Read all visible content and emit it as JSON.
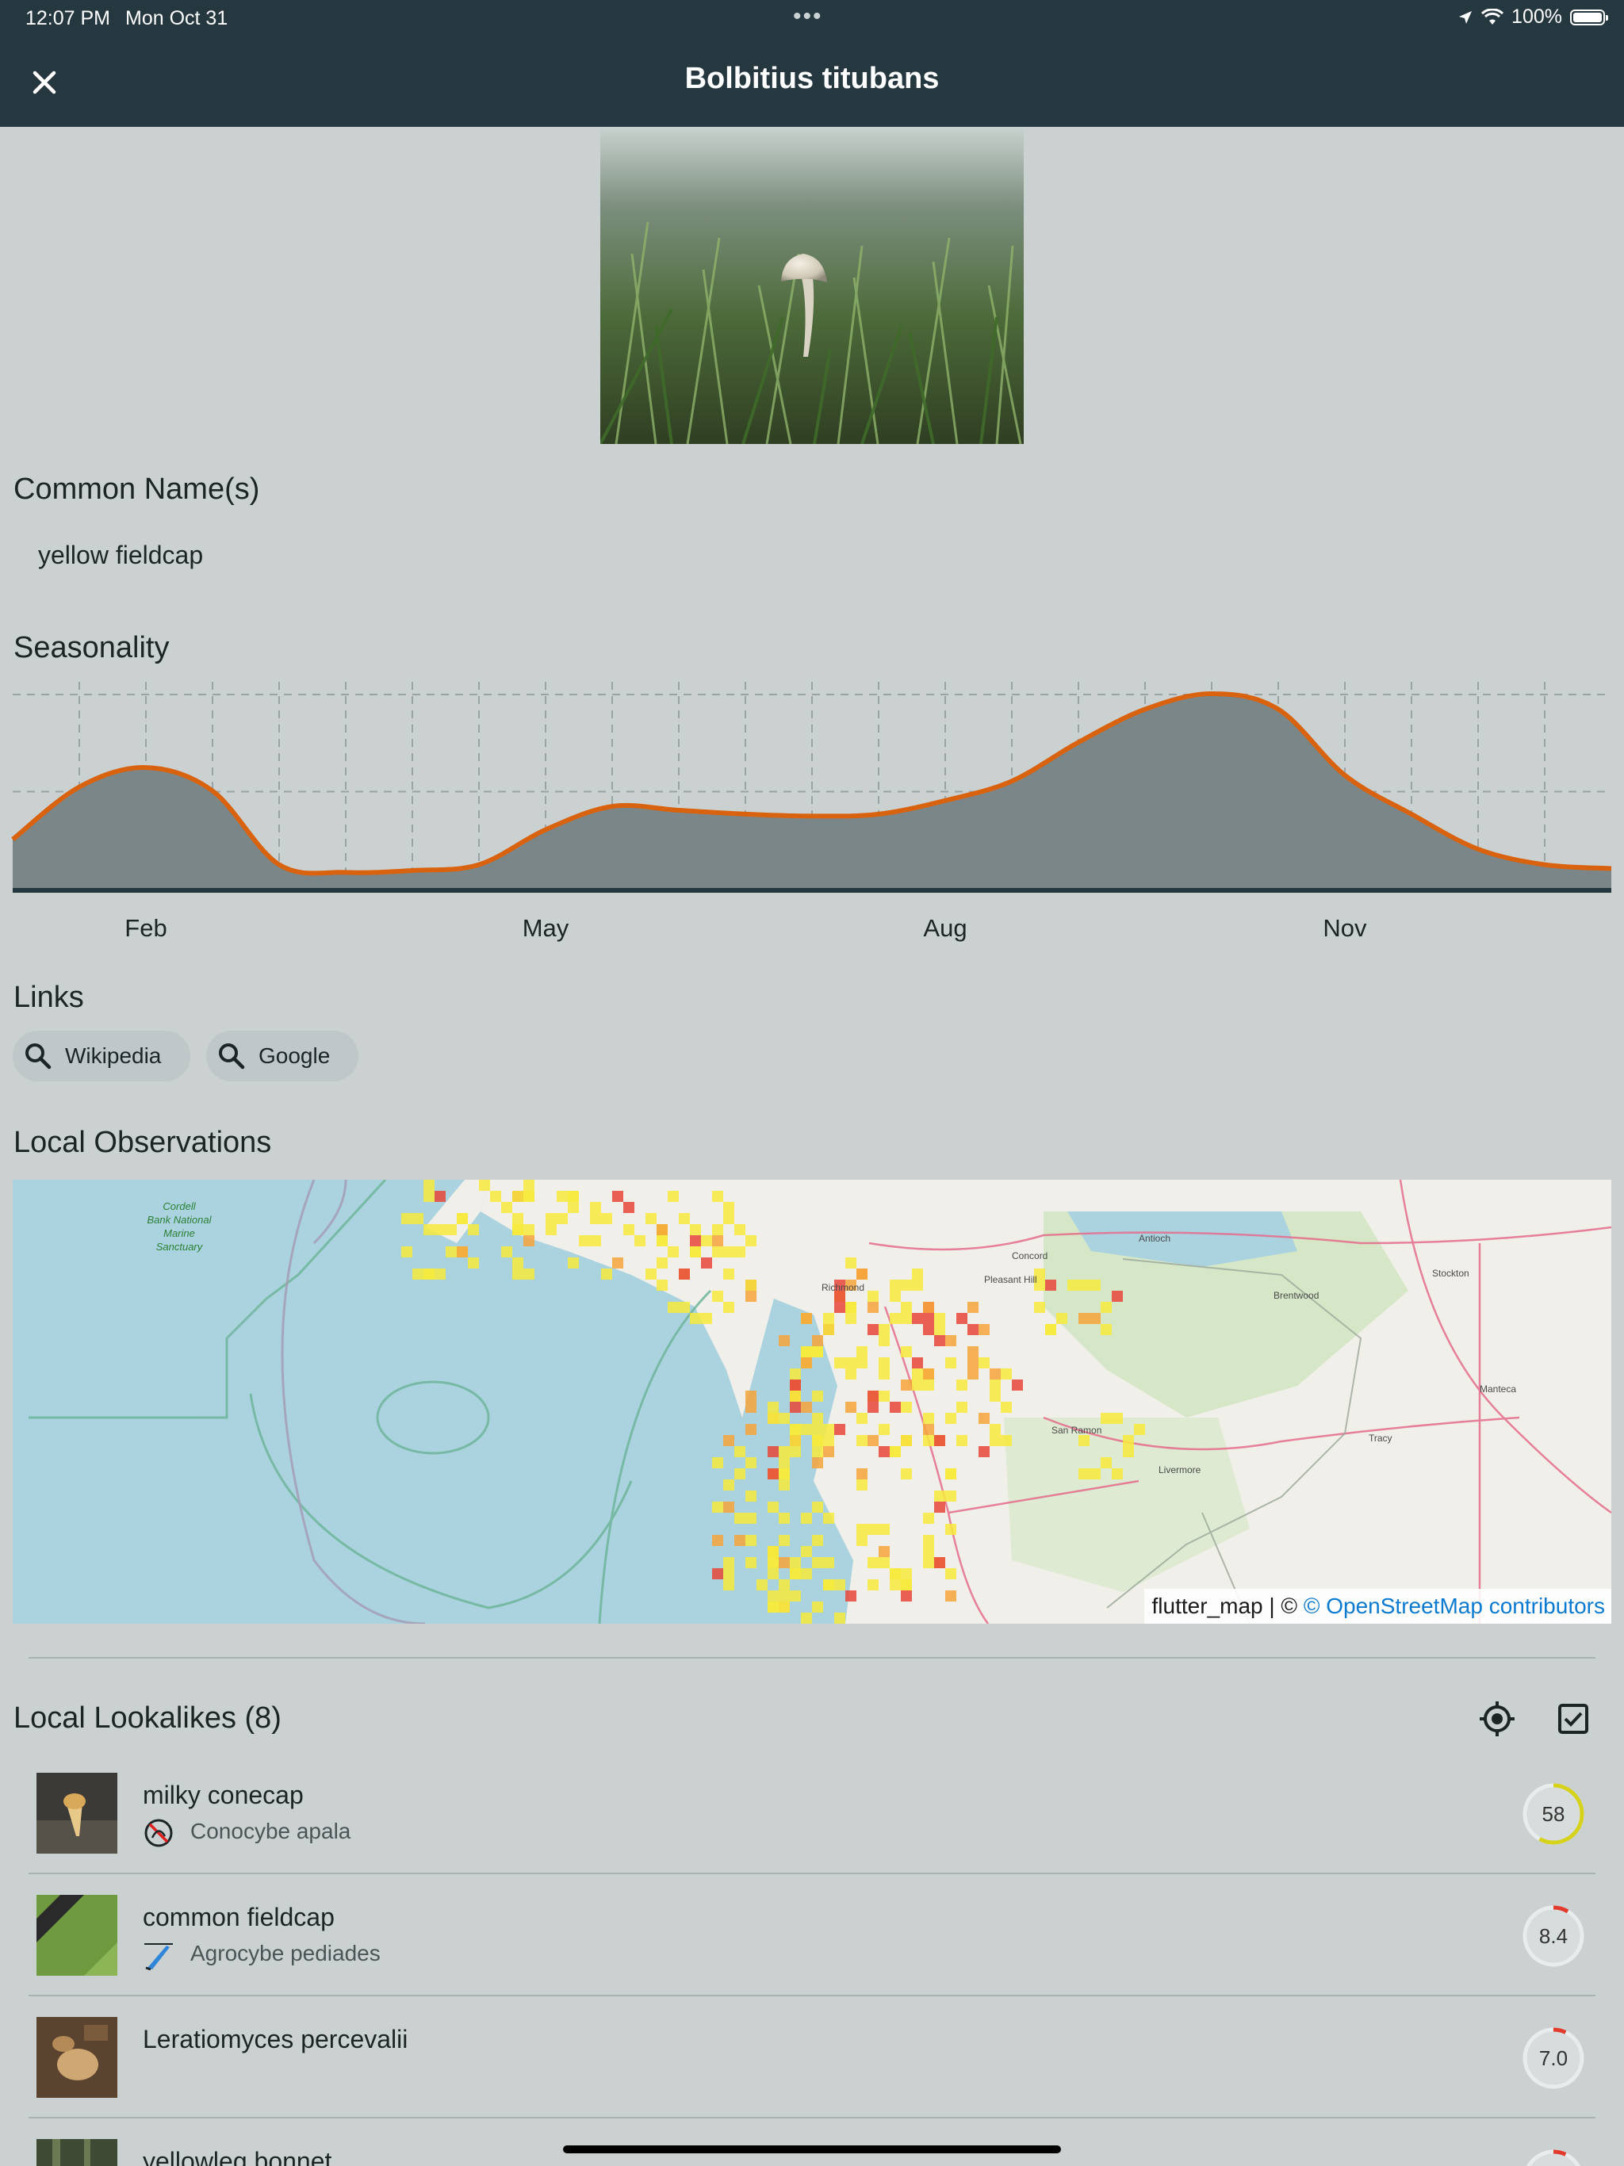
{
  "status": {
    "time": "12:07 PM",
    "date": "Mon Oct 31",
    "battery": "100%"
  },
  "appbar": {
    "title": "Bolbitius titubans",
    "close_icon": "close-icon"
  },
  "sections": {
    "common_names": "Common Name(s)",
    "seasonality": "Seasonality",
    "links": "Links",
    "observations": "Local Observations",
    "lookalikes": "Local Lookalikes (8)"
  },
  "common_name": "yellow fieldcap",
  "chart_data": {
    "type": "area",
    "title": "Seasonality",
    "x": [
      1,
      2,
      3,
      4,
      5,
      6,
      7,
      8,
      9,
      10,
      11,
      12,
      13,
      14,
      15,
      16,
      17,
      18,
      19,
      20,
      21,
      22,
      23,
      24,
      25
    ],
    "values": [
      0.25,
      0.52,
      0.62,
      0.5,
      0.12,
      0.08,
      0.09,
      0.12,
      0.3,
      0.42,
      0.4,
      0.38,
      0.37,
      0.38,
      0.45,
      0.55,
      0.75,
      0.92,
      1.0,
      0.92,
      0.58,
      0.38,
      0.2,
      0.12,
      0.1
    ],
    "tick_labels": [
      "Feb",
      "May",
      "Aug",
      "Nov"
    ],
    "ylim": [
      0,
      1
    ],
    "grid": true,
    "colors": {
      "line": "#d9620e",
      "fill": "#7b8689"
    }
  },
  "links": [
    {
      "label": "Wikipedia",
      "icon": "search-icon"
    },
    {
      "label": "Google",
      "icon": "search-icon"
    }
  ],
  "map": {
    "attribution_prefix": "flutter_map | © ",
    "attribution_link": "© OpenStreetMap contributors",
    "place_labels": [
      "Cordell Bank National Marine Sanctuary",
      "Concord",
      "Antioch",
      "Stockton",
      "Richmond",
      "Tracy",
      "Manteca",
      "Livermore",
      "San Ramon",
      "Pleasant Hill",
      "Brentwood"
    ]
  },
  "lookalike_actions": {
    "locate_icon": "my-location-icon",
    "filter_icon": "checkbox-icon"
  },
  "lookalikes": [
    {
      "name": "milky conecap",
      "sci": "Conocybe apala",
      "score": "58",
      "score_fraction": 0.58,
      "edibility_icon": "not-edible-icon",
      "ring_color": "#d6d21a"
    },
    {
      "name": "common fieldcap",
      "sci": "Agrocybe pediades",
      "score": "8.4",
      "score_fraction": 0.084,
      "edibility_icon": "knife-icon",
      "ring_color": "#e23b2b"
    },
    {
      "name": "Leratiomyces percevalii",
      "sci": "",
      "score": "7.0",
      "score_fraction": 0.07,
      "edibility_icon": "",
      "ring_color": "#e23b2b"
    },
    {
      "name": "yellowleg bonnet",
      "sci": "",
      "score": "",
      "score_fraction": 0.07,
      "edibility_icon": "",
      "ring_color": "#e23b2b"
    }
  ]
}
